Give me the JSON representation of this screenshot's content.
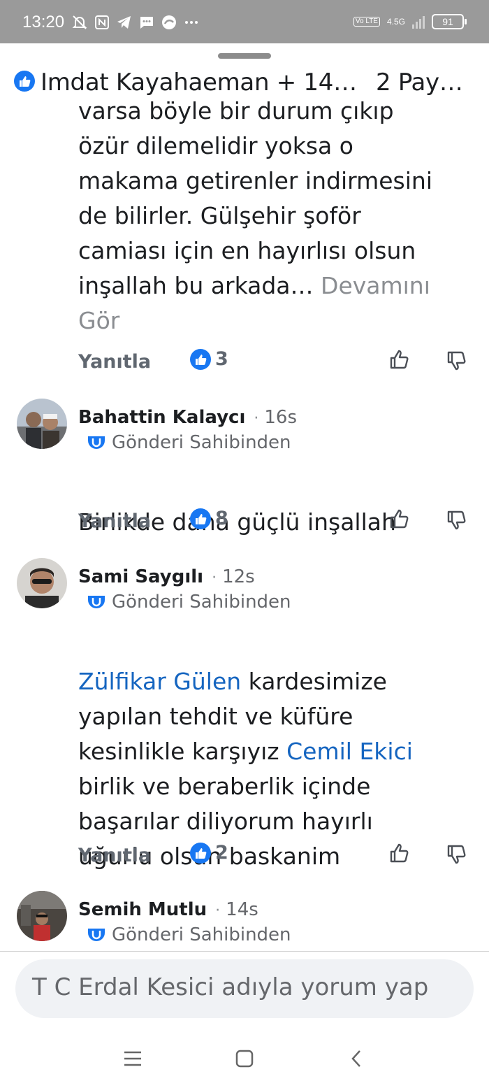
{
  "status_bar": {
    "time": "13:20",
    "network_volte": "Vo LTE",
    "network_type": "4.5G",
    "battery": "91",
    "icons": [
      "mute-bell-icon",
      "nfc-icon",
      "telegram-icon",
      "message-icon",
      "turkcell-icon",
      "more-dots-icon"
    ]
  },
  "header": {
    "title": "Imdat Kayahaeman + 14…",
    "shares": "2 Pay…"
  },
  "comments": [
    {
      "partial": true,
      "lines": [
        "varsa böyle bir durum çıkıp",
        "özür dilemelidir yoksa o",
        "makama getirenler indirmesini",
        "de bilirler. Gülşehir şoför",
        "camiası için en hayırlısı olsun",
        "inşallah bu arkada…"
      ],
      "see_more": "Devamını Gör",
      "reply_label": "Yanıtla",
      "reaction_count": "3"
    },
    {
      "name": "Bahattin Kalaycı",
      "time": "16s",
      "badge": "Gönderi Sahibinden",
      "text": "Birlikde daha güçlü inşallah",
      "reply_label": "Yanıtla",
      "reaction_count": "8"
    },
    {
      "name": "Sami Saygılı",
      "time": "12s",
      "badge": "Gönderi Sahibinden",
      "mention_1": "Zülfikar Gülen",
      "text_1": " kardesimize",
      "line_2": "yapılan tehdit ve küfüre",
      "line_3a": "kesinlikle karşıyız ",
      "mention_2": "Cemil Ekici",
      "line_4": "birlik ve beraberlik içinde",
      "line_5": "başarılar diliyorum hayırlı",
      "line_6": "uğurlu olsun baskanim",
      "reply_label": "Yanıtla",
      "reaction_count": "2"
    },
    {
      "name": "Semih Mutlu",
      "time": "14s",
      "badge": "Gönderi Sahibinden"
    }
  ],
  "composer": {
    "placeholder": "T C Erdal Kesici adıyla yorum yap"
  },
  "colors": {
    "facebook_blue": "#1877f2",
    "mention_blue": "#1565c0",
    "status_bar_gray": "#9a9a9a"
  }
}
